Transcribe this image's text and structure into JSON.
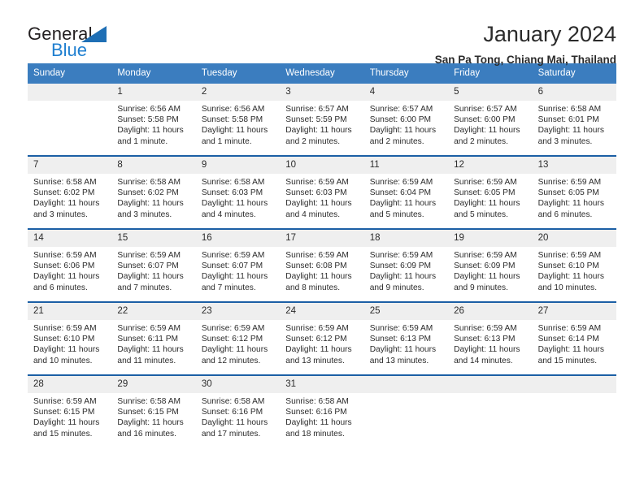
{
  "brand": {
    "name_top": "General",
    "name_bottom": "Blue",
    "triangle_color": "#1f6fb5",
    "blue_color": "#1f7fd0"
  },
  "header": {
    "title": "January 2024",
    "subtitle": "San Pa Tong, Chiang Mai, Thailand"
  },
  "theme": {
    "header_bar": "#3b7dbf",
    "row_divider": "#1c5fa5",
    "daynum_band": "#efefef"
  },
  "weekdays": [
    "Sunday",
    "Monday",
    "Tuesday",
    "Wednesday",
    "Thursday",
    "Friday",
    "Saturday"
  ],
  "weeks": [
    [
      {
        "day": "",
        "sunrise": "",
        "sunset": "",
        "daylight1": "",
        "daylight2": ""
      },
      {
        "day": "1",
        "sunrise": "Sunrise: 6:56 AM",
        "sunset": "Sunset: 5:58 PM",
        "daylight1": "Daylight: 11 hours",
        "daylight2": "and 1 minute."
      },
      {
        "day": "2",
        "sunrise": "Sunrise: 6:56 AM",
        "sunset": "Sunset: 5:58 PM",
        "daylight1": "Daylight: 11 hours",
        "daylight2": "and 1 minute."
      },
      {
        "day": "3",
        "sunrise": "Sunrise: 6:57 AM",
        "sunset": "Sunset: 5:59 PM",
        "daylight1": "Daylight: 11 hours",
        "daylight2": "and 2 minutes."
      },
      {
        "day": "4",
        "sunrise": "Sunrise: 6:57 AM",
        "sunset": "Sunset: 6:00 PM",
        "daylight1": "Daylight: 11 hours",
        "daylight2": "and 2 minutes."
      },
      {
        "day": "5",
        "sunrise": "Sunrise: 6:57 AM",
        "sunset": "Sunset: 6:00 PM",
        "daylight1": "Daylight: 11 hours",
        "daylight2": "and 2 minutes."
      },
      {
        "day": "6",
        "sunrise": "Sunrise: 6:58 AM",
        "sunset": "Sunset: 6:01 PM",
        "daylight1": "Daylight: 11 hours",
        "daylight2": "and 3 minutes."
      }
    ],
    [
      {
        "day": "7",
        "sunrise": "Sunrise: 6:58 AM",
        "sunset": "Sunset: 6:02 PM",
        "daylight1": "Daylight: 11 hours",
        "daylight2": "and 3 minutes."
      },
      {
        "day": "8",
        "sunrise": "Sunrise: 6:58 AM",
        "sunset": "Sunset: 6:02 PM",
        "daylight1": "Daylight: 11 hours",
        "daylight2": "and 3 minutes."
      },
      {
        "day": "9",
        "sunrise": "Sunrise: 6:58 AM",
        "sunset": "Sunset: 6:03 PM",
        "daylight1": "Daylight: 11 hours",
        "daylight2": "and 4 minutes."
      },
      {
        "day": "10",
        "sunrise": "Sunrise: 6:59 AM",
        "sunset": "Sunset: 6:03 PM",
        "daylight1": "Daylight: 11 hours",
        "daylight2": "and 4 minutes."
      },
      {
        "day": "11",
        "sunrise": "Sunrise: 6:59 AM",
        "sunset": "Sunset: 6:04 PM",
        "daylight1": "Daylight: 11 hours",
        "daylight2": "and 5 minutes."
      },
      {
        "day": "12",
        "sunrise": "Sunrise: 6:59 AM",
        "sunset": "Sunset: 6:05 PM",
        "daylight1": "Daylight: 11 hours",
        "daylight2": "and 5 minutes."
      },
      {
        "day": "13",
        "sunrise": "Sunrise: 6:59 AM",
        "sunset": "Sunset: 6:05 PM",
        "daylight1": "Daylight: 11 hours",
        "daylight2": "and 6 minutes."
      }
    ],
    [
      {
        "day": "14",
        "sunrise": "Sunrise: 6:59 AM",
        "sunset": "Sunset: 6:06 PM",
        "daylight1": "Daylight: 11 hours",
        "daylight2": "and 6 minutes."
      },
      {
        "day": "15",
        "sunrise": "Sunrise: 6:59 AM",
        "sunset": "Sunset: 6:07 PM",
        "daylight1": "Daylight: 11 hours",
        "daylight2": "and 7 minutes."
      },
      {
        "day": "16",
        "sunrise": "Sunrise: 6:59 AM",
        "sunset": "Sunset: 6:07 PM",
        "daylight1": "Daylight: 11 hours",
        "daylight2": "and 7 minutes."
      },
      {
        "day": "17",
        "sunrise": "Sunrise: 6:59 AM",
        "sunset": "Sunset: 6:08 PM",
        "daylight1": "Daylight: 11 hours",
        "daylight2": "and 8 minutes."
      },
      {
        "day": "18",
        "sunrise": "Sunrise: 6:59 AM",
        "sunset": "Sunset: 6:09 PM",
        "daylight1": "Daylight: 11 hours",
        "daylight2": "and 9 minutes."
      },
      {
        "day": "19",
        "sunrise": "Sunrise: 6:59 AM",
        "sunset": "Sunset: 6:09 PM",
        "daylight1": "Daylight: 11 hours",
        "daylight2": "and 9 minutes."
      },
      {
        "day": "20",
        "sunrise": "Sunrise: 6:59 AM",
        "sunset": "Sunset: 6:10 PM",
        "daylight1": "Daylight: 11 hours",
        "daylight2": "and 10 minutes."
      }
    ],
    [
      {
        "day": "21",
        "sunrise": "Sunrise: 6:59 AM",
        "sunset": "Sunset: 6:10 PM",
        "daylight1": "Daylight: 11 hours",
        "daylight2": "and 10 minutes."
      },
      {
        "day": "22",
        "sunrise": "Sunrise: 6:59 AM",
        "sunset": "Sunset: 6:11 PM",
        "daylight1": "Daylight: 11 hours",
        "daylight2": "and 11 minutes."
      },
      {
        "day": "23",
        "sunrise": "Sunrise: 6:59 AM",
        "sunset": "Sunset: 6:12 PM",
        "daylight1": "Daylight: 11 hours",
        "daylight2": "and 12 minutes."
      },
      {
        "day": "24",
        "sunrise": "Sunrise: 6:59 AM",
        "sunset": "Sunset: 6:12 PM",
        "daylight1": "Daylight: 11 hours",
        "daylight2": "and 13 minutes."
      },
      {
        "day": "25",
        "sunrise": "Sunrise: 6:59 AM",
        "sunset": "Sunset: 6:13 PM",
        "daylight1": "Daylight: 11 hours",
        "daylight2": "and 13 minutes."
      },
      {
        "day": "26",
        "sunrise": "Sunrise: 6:59 AM",
        "sunset": "Sunset: 6:13 PM",
        "daylight1": "Daylight: 11 hours",
        "daylight2": "and 14 minutes."
      },
      {
        "day": "27",
        "sunrise": "Sunrise: 6:59 AM",
        "sunset": "Sunset: 6:14 PM",
        "daylight1": "Daylight: 11 hours",
        "daylight2": "and 15 minutes."
      }
    ],
    [
      {
        "day": "28",
        "sunrise": "Sunrise: 6:59 AM",
        "sunset": "Sunset: 6:15 PM",
        "daylight1": "Daylight: 11 hours",
        "daylight2": "and 15 minutes."
      },
      {
        "day": "29",
        "sunrise": "Sunrise: 6:58 AM",
        "sunset": "Sunset: 6:15 PM",
        "daylight1": "Daylight: 11 hours",
        "daylight2": "and 16 minutes."
      },
      {
        "day": "30",
        "sunrise": "Sunrise: 6:58 AM",
        "sunset": "Sunset: 6:16 PM",
        "daylight1": "Daylight: 11 hours",
        "daylight2": "and 17 minutes."
      },
      {
        "day": "31",
        "sunrise": "Sunrise: 6:58 AM",
        "sunset": "Sunset: 6:16 PM",
        "daylight1": "Daylight: 11 hours",
        "daylight2": "and 18 minutes."
      },
      {
        "day": "",
        "sunrise": "",
        "sunset": "",
        "daylight1": "",
        "daylight2": ""
      },
      {
        "day": "",
        "sunrise": "",
        "sunset": "",
        "daylight1": "",
        "daylight2": ""
      },
      {
        "day": "",
        "sunrise": "",
        "sunset": "",
        "daylight1": "",
        "daylight2": ""
      }
    ]
  ]
}
